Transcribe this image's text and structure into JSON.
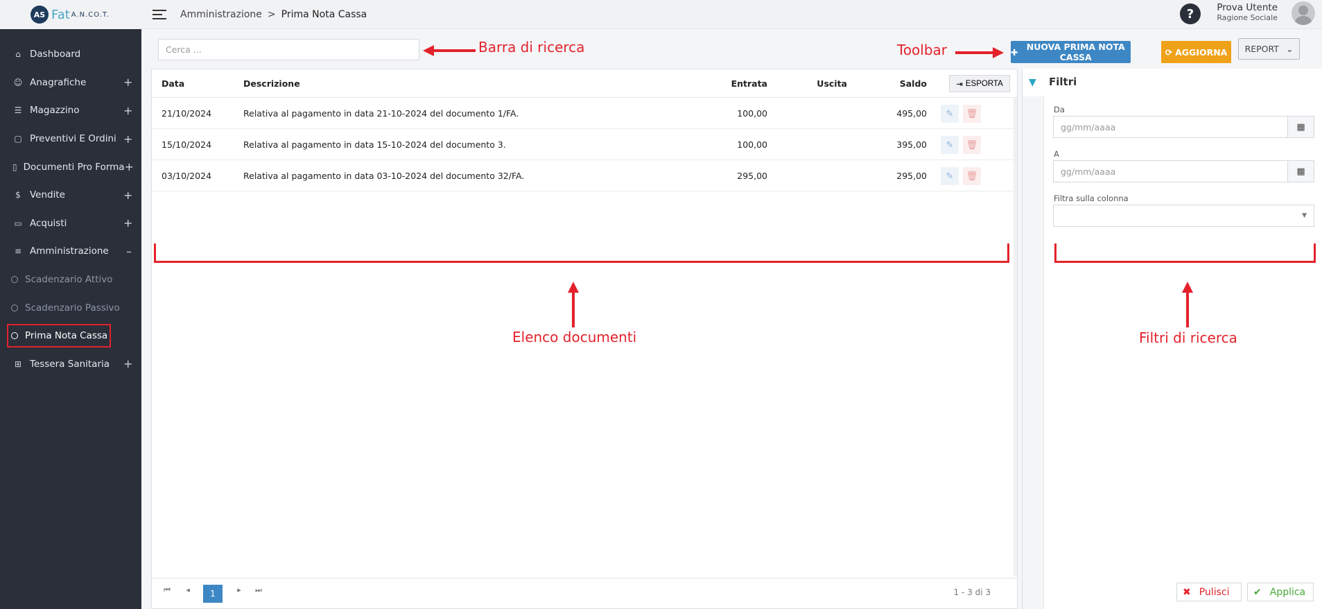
{
  "app": {
    "logo_mark": "AS",
    "logo_name": "Fat",
    "logo_suffix": "A.N.CO.T."
  },
  "sidebar": {
    "items": [
      {
        "label": "Dashboard",
        "icon": "home-icon",
        "glyph": "⌂",
        "expand": ""
      },
      {
        "label": "Anagrafiche",
        "icon": "user-icon",
        "glyph": "☺",
        "expand": "+"
      },
      {
        "label": "Magazzino",
        "icon": "list-icon",
        "glyph": "☰",
        "expand": "+"
      },
      {
        "label": "Preventivi E Ordini",
        "icon": "clipboard-icon",
        "glyph": "▢",
        "expand": "+"
      },
      {
        "label": "Documenti Pro Forma",
        "icon": "document-icon",
        "glyph": "▯",
        "expand": "+"
      },
      {
        "label": "Vendite",
        "icon": "dollar-icon",
        "glyph": "$",
        "expand": "+"
      },
      {
        "label": "Acquisti",
        "icon": "card-icon",
        "glyph": "▭",
        "expand": "+"
      },
      {
        "label": "Amministrazione",
        "icon": "database-icon",
        "glyph": "≡",
        "expand": "–"
      }
    ],
    "subitems": [
      {
        "label": "Scadenzario Attivo"
      },
      {
        "label": "Scadenzario Passivo"
      },
      {
        "label": "Prima Nota Cassa"
      }
    ],
    "last_item": {
      "label": "Tessera Sanitaria",
      "icon": "medical-case-icon",
      "glyph": "⊞",
      "expand": "+"
    }
  },
  "header": {
    "breadcrumb_parent": "Amministrazione",
    "breadcrumb_sep": ">",
    "breadcrumb_current": "Prima Nota Cassa",
    "help": "?",
    "user_name": "Prova Utente",
    "user_company": "Ragione Sociale"
  },
  "search": {
    "placeholder": "Cerca ..."
  },
  "toolbar": {
    "new_label": "NUOVA PRIMA NOTA CASSA",
    "refresh_label": "AGGIORNA",
    "report_label": "REPORT"
  },
  "table": {
    "columns": [
      "Data",
      "Descrizione",
      "Entrata",
      "Uscita",
      "Saldo"
    ],
    "export_label": "ESPORTA",
    "rows": [
      {
        "data": "21/10/2024",
        "descrizione": "Relativa al pagamento in data 21-10-2024 del documento 1/FA.",
        "entrata": "100,00",
        "uscita": "",
        "saldo": "495,00"
      },
      {
        "data": "15/10/2024",
        "descrizione": "Relativa al pagamento in data 15-10-2024 del documento 3.",
        "entrata": "100,00",
        "uscita": "",
        "saldo": "395,00"
      },
      {
        "data": "03/10/2024",
        "descrizione": "Relativa al pagamento in data 03-10-2024 del documento 32/FA.",
        "entrata": "295,00",
        "uscita": "",
        "saldo": "295,00"
      }
    ],
    "pager": {
      "current": "1",
      "info": "1 - 3 di 3"
    }
  },
  "filters": {
    "title": "Filtri",
    "from_label": "Da",
    "from_placeholder": "gg/mm/aaaa",
    "to_label": "A",
    "to_placeholder": "gg/mm/aaaa",
    "column_label": "Filtra sulla colonna",
    "clear_label": "Pulisci",
    "apply_label": "Applica"
  },
  "annotations": {
    "search_bar": "Barra di ricerca",
    "toolbar": "Toolbar",
    "document_list": "Elenco documenti",
    "search_filters": "Filtri di ricerca"
  },
  "colors": {
    "sidebar": "#2a2f3a",
    "primary": "#3d87c4",
    "warning": "#f0a11a",
    "annotation": "#e3222b",
    "filter_icon": "#2aa6c6"
  }
}
